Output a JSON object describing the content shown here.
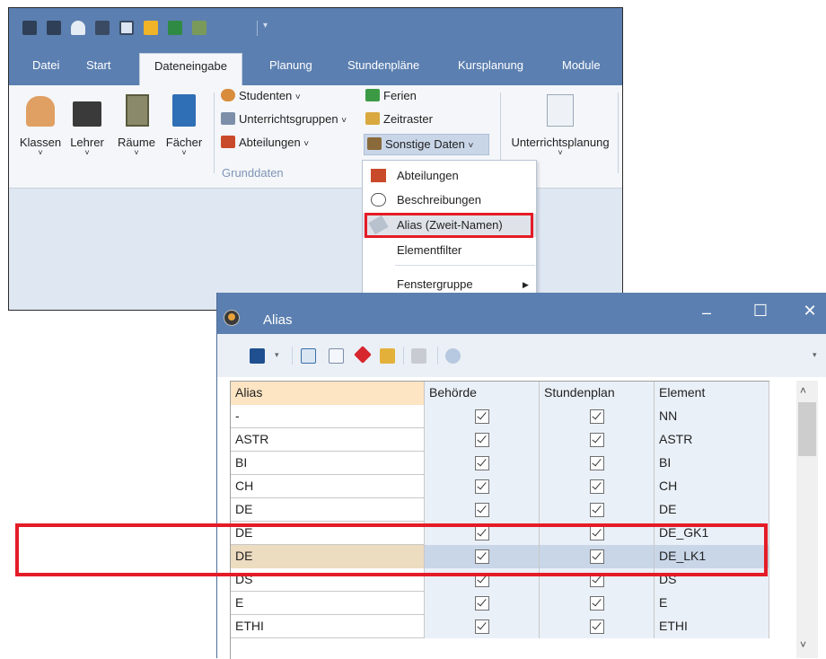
{
  "main_window": {
    "tabs": [
      "Datei",
      "Start",
      "Dateneingabe",
      "Planung",
      "Stundenpläne",
      "Kursplanung",
      "Module"
    ],
    "active_tab": "Dateneingabe",
    "big_buttons": [
      "Klassen",
      "Lehrer",
      "Räume",
      "Fächer"
    ],
    "small_buttons": {
      "studenten": "Studenten",
      "unterrichtsgruppen": "Unterrichtsgruppen",
      "abteilungen": "Abteilungen",
      "ferien": "Ferien",
      "zeitraster": "Zeitraster",
      "sonstige": "Sonstige Daten"
    },
    "chevron": "˅",
    "group_label": "Grunddaten",
    "unterrichtsplanung": "Unterrichtsplanung"
  },
  "menu": {
    "items": [
      "Abteilungen",
      "Beschreibungen",
      "Alias (Zweit-Namen)",
      "Elementfilter",
      "Fenstergruppe"
    ],
    "highlighted": "Alias (Zweit-Namen)"
  },
  "alias_window": {
    "title": "Alias",
    "controls": {
      "minimize": "‒",
      "maximize": "☐",
      "close": "✕"
    },
    "columns": [
      "Alias",
      "Behörde",
      "Stundenplan",
      "Element"
    ],
    "rows": [
      {
        "alias": "-",
        "behoerde": true,
        "stundenplan": true,
        "element": "NN"
      },
      {
        "alias": "ASTR",
        "behoerde": true,
        "stundenplan": true,
        "element": "ASTR"
      },
      {
        "alias": "BI",
        "behoerde": true,
        "stundenplan": true,
        "element": "BI"
      },
      {
        "alias": "CH",
        "behoerde": true,
        "stundenplan": true,
        "element": "CH"
      },
      {
        "alias": "DE",
        "behoerde": true,
        "stundenplan": true,
        "element": "DE"
      },
      {
        "alias": "DE",
        "behoerde": true,
        "stundenplan": true,
        "element": "DE_GK1"
      },
      {
        "alias": "DE",
        "behoerde": true,
        "stundenplan": true,
        "element": "DE_LK1"
      },
      {
        "alias": "DS",
        "behoerde": true,
        "stundenplan": true,
        "element": "DS"
      },
      {
        "alias": "E",
        "behoerde": true,
        "stundenplan": true,
        "element": "E"
      },
      {
        "alias": "ETHI",
        "behoerde": true,
        "stundenplan": true,
        "element": "ETHI"
      }
    ],
    "selected_row_index": 6
  },
  "colors": {
    "title_bar": "#5b7fb0",
    "highlight_red": "#e41c27",
    "selected_row": "#c9d6e8",
    "alias_header": "#fde4c3"
  }
}
